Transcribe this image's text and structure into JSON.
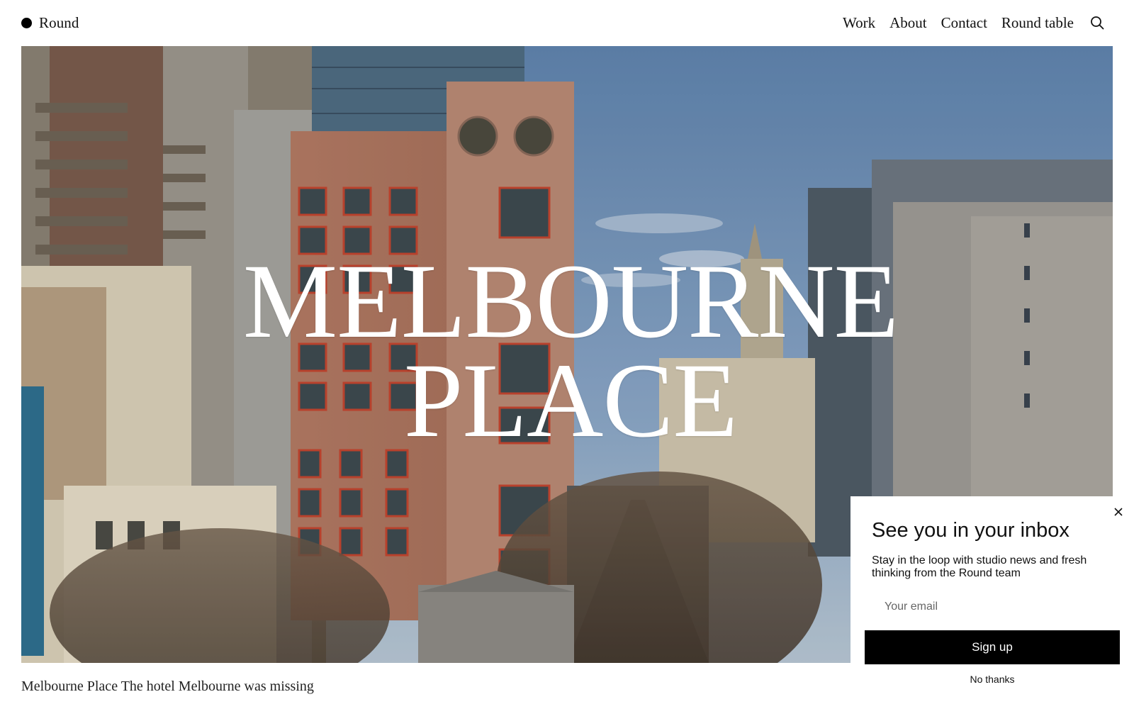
{
  "header": {
    "brand": "Round",
    "nav": [
      "Work",
      "About",
      "Contact",
      "Round table"
    ],
    "search_icon": "search-icon"
  },
  "hero": {
    "title_line1": "MELBOURNE",
    "title_line2": "PLACE",
    "image": "city street with brick hotel tower and blue sky"
  },
  "caption": "Melbourne Place The hotel Melbourne was missing",
  "newsletter": {
    "title": "See you in your inbox",
    "description": "Stay in the loop with studio news and fresh thinking from the Round team",
    "email_placeholder": "Your email",
    "signup_label": "Sign up",
    "dismiss_label": "No thanks",
    "close_icon": "close-icon"
  }
}
